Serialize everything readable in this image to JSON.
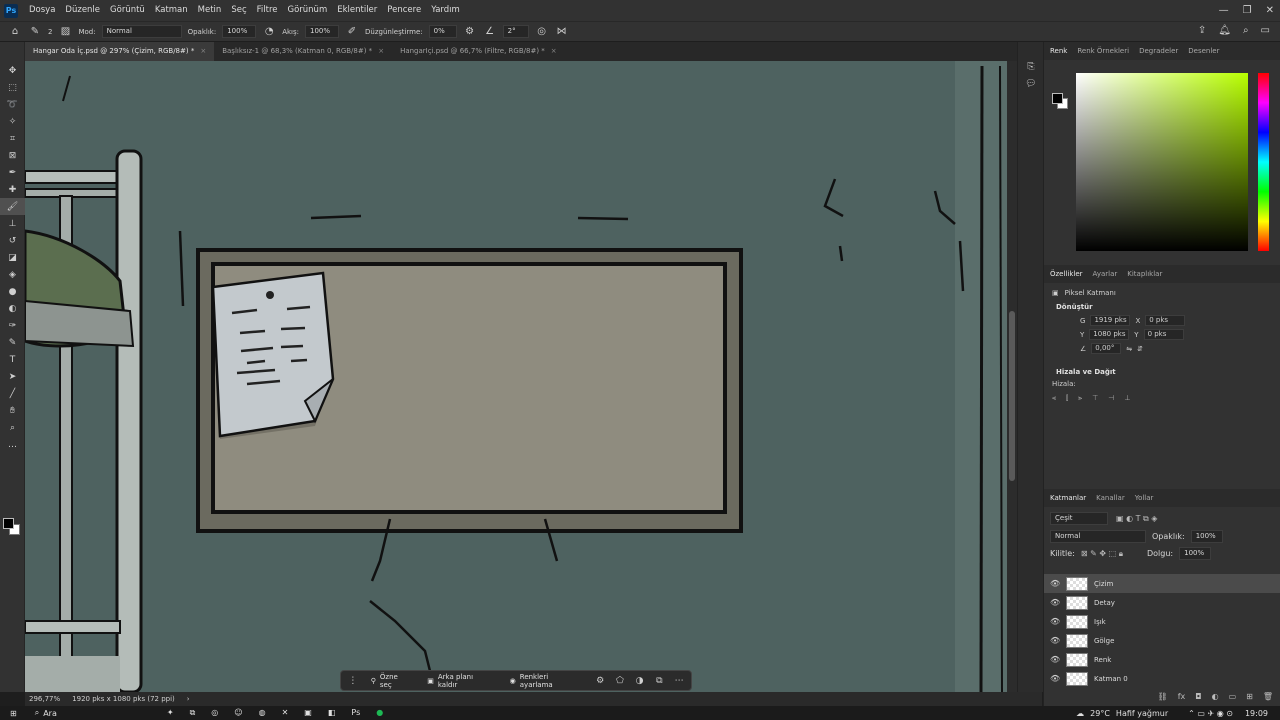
{
  "app": {
    "logo": "Ps"
  },
  "menu": [
    "Dosya",
    "Düzenle",
    "Görüntü",
    "Katman",
    "Metin",
    "Seç",
    "Filtre",
    "Görünüm",
    "Eklentiler",
    "Pencere",
    "Yardım"
  ],
  "options": {
    "brush_size": "2",
    "mode_label": "Mod:",
    "mode_value": "Normal",
    "opacity_label": "Opaklık:",
    "opacity_value": "100%",
    "flow_label": "Akış:",
    "flow_value": "100%",
    "smoothing_label": "Düzgünleştirme:",
    "smoothing_value": "0%",
    "angle_value": "2°"
  },
  "tabs": [
    {
      "label": "Hangar Oda İç.psd @ 297% (Çizim, RGB/8#) *",
      "active": true
    },
    {
      "label": "Başlıksız-1 @ 68,3% (Katman 0, RGB/8#) *",
      "active": false
    },
    {
      "label": "HangarIçi.psd @ 66,7% (Filtre, RGB/8#) *",
      "active": false
    }
  ],
  "context_bar": {
    "select_subject": "Özne seç",
    "remove_bg": "Arka planı kaldır",
    "adjust_colors": "Renkleri ayarlama"
  },
  "status": {
    "zoom": "296,77%",
    "doc_size": "1920 pks x 1080 pks (72 ppi)"
  },
  "color_panel": {
    "tabs": [
      "Renk",
      "Renk Örnekleri",
      "Degradeler",
      "Desenler"
    ],
    "foreground": "#000000",
    "background": "#ffffff",
    "hue_color": "#b8ff00"
  },
  "properties": {
    "tabs": [
      "Özellikler",
      "Ayarlar",
      "Kitaplıklar"
    ],
    "kind": "Piksel Katmanı",
    "transform_title": "Dönüştür",
    "w_label": "G",
    "w_value": "1919 pks",
    "h_label": "Y",
    "h_value": "1080 pks",
    "x_label": "X",
    "x_value": "0 pks",
    "y_label": "Y",
    "y_value": "0 pks",
    "angle_value": "0,00°",
    "align_title": "Hizala ve Dağıt",
    "align_label": "Hizala:"
  },
  "layers_panel": {
    "tabs": [
      "Katmanlar",
      "Kanallar",
      "Yollar"
    ],
    "filter": "Çeşit",
    "blend": "Normal",
    "opacity_label": "Opaklık:",
    "opacity_value": "100%",
    "lock_label": "Kilitle:",
    "fill_label": "Dolgu:",
    "fill_value": "100%",
    "layers": [
      {
        "name": "Çizim",
        "selected": true
      },
      {
        "name": "Detay",
        "selected": false
      },
      {
        "name": "Işık",
        "selected": false
      },
      {
        "name": "Gölge",
        "selected": false
      },
      {
        "name": "Renk",
        "selected": false
      },
      {
        "name": "Katman 0",
        "selected": false
      }
    ]
  },
  "taskbar": {
    "search": "Ara",
    "weather": "29°C",
    "weather_desc": "Hafif yağmur",
    "time": "19:09"
  }
}
